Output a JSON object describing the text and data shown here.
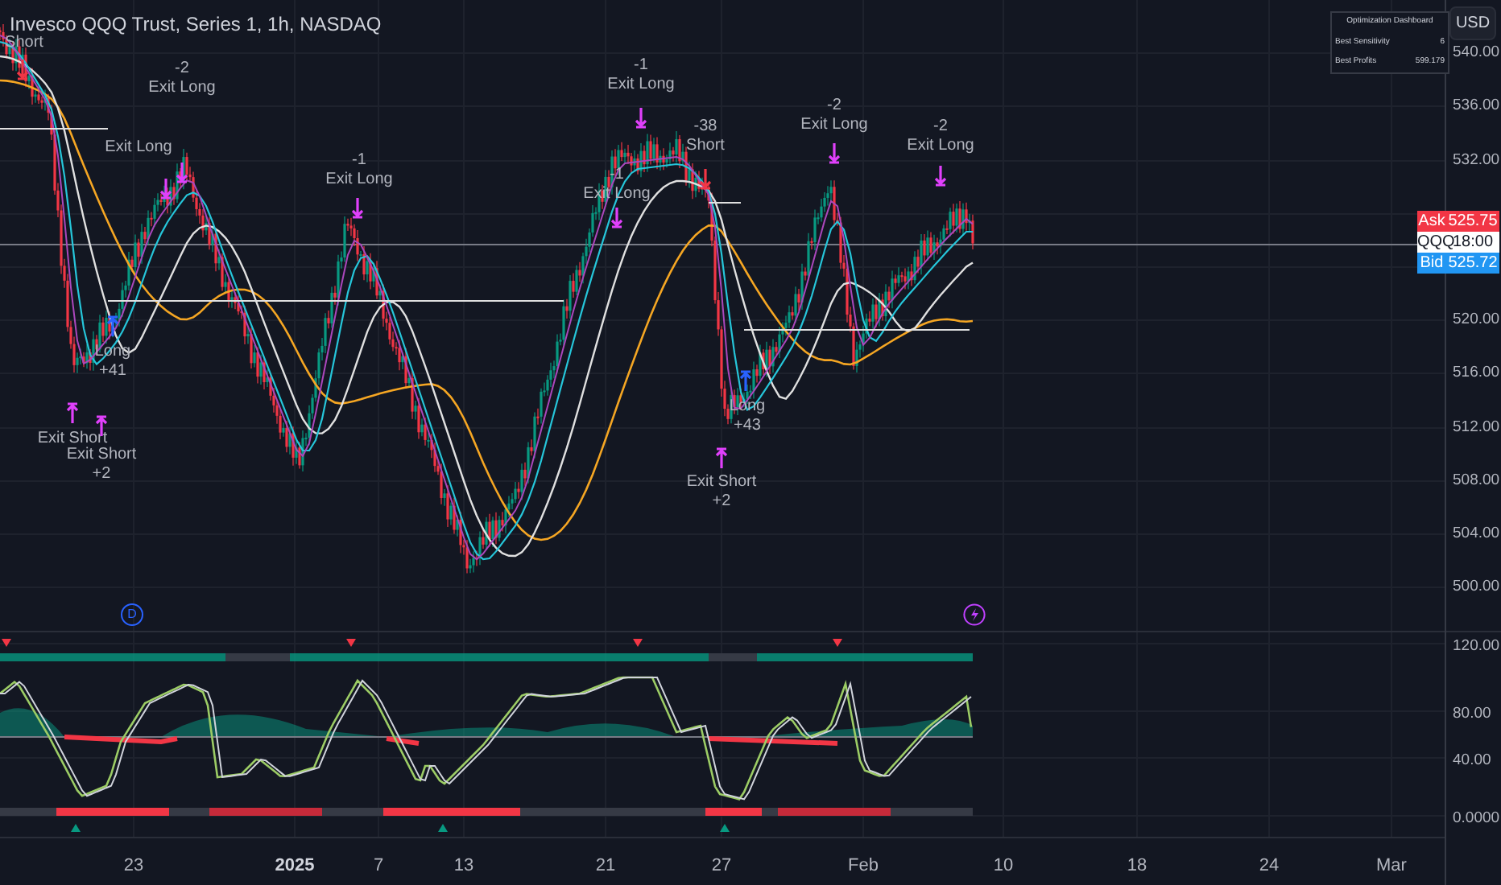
{
  "header": {
    "title": "Invesco QQQ Trust, Series 1, 1h, NASDAQ"
  },
  "currency_button": "USD",
  "dashboard": {
    "title": "Optimization Dashboard",
    "rows": [
      {
        "label": "Best Sensitivity",
        "value": "6"
      },
      {
        "label": "Best Profits",
        "value": "599.179"
      }
    ]
  },
  "price_axis": [
    "540.00",
    "536.00",
    "532.00",
    "520.00",
    "516.00",
    "512.00",
    "508.00",
    "504.00",
    "500.00"
  ],
  "quote_tags": [
    {
      "kind": "ask",
      "label": "Ask",
      "value": "525.75"
    },
    {
      "kind": "symbol",
      "label": "QQQ",
      "value": "18:00"
    },
    {
      "kind": "bid",
      "label": "Bid",
      "value": "525.72"
    }
  ],
  "trades": [
    {
      "kind": "short",
      "lines": [
        "Short"
      ]
    },
    {
      "kind": "exit_long",
      "lines": [
        "-2",
        "Exit Long"
      ]
    },
    {
      "kind": "exit_long",
      "lines": [
        "Exit Long"
      ]
    },
    {
      "kind": "exit_long",
      "lines": [
        "-1",
        "Exit Long"
      ]
    },
    {
      "kind": "exit_long",
      "lines": [
        "-1",
        "Exit Long"
      ]
    },
    {
      "kind": "exit_long",
      "lines": [
        "-1",
        "Exit Long"
      ]
    },
    {
      "kind": "short",
      "lines": [
        "-38",
        "Short"
      ]
    },
    {
      "kind": "exit_long",
      "lines": [
        "-2",
        "Exit Long"
      ]
    },
    {
      "kind": "exit_long",
      "lines": [
        "-2",
        "Exit Long"
      ]
    },
    {
      "kind": "long",
      "lines": [
        "Long",
        "+41"
      ]
    },
    {
      "kind": "exit_short",
      "lines": [
        "Exit Short"
      ]
    },
    {
      "kind": "exit_short",
      "lines": [
        "Exit Short",
        "+2"
      ]
    },
    {
      "kind": "long",
      "lines": [
        "Long",
        "+43"
      ]
    },
    {
      "kind": "exit_short",
      "lines": [
        "Exit Short",
        "+2"
      ]
    }
  ],
  "markers": [
    {
      "kind": "dividend",
      "label": "D"
    },
    {
      "kind": "event"
    }
  ],
  "oscillator_axis": [
    "120.00",
    "80.00",
    "40.00",
    "0.0000"
  ],
  "time_axis": [
    {
      "label": "23",
      "emphasis": false
    },
    {
      "label": "2025",
      "emphasis": true
    },
    {
      "label": "7",
      "emphasis": false
    },
    {
      "label": "13",
      "emphasis": false
    },
    {
      "label": "21",
      "emphasis": false
    },
    {
      "label": "27",
      "emphasis": false
    },
    {
      "label": "Feb",
      "emphasis": false
    },
    {
      "label": "10",
      "emphasis": false
    },
    {
      "label": "18",
      "emphasis": false
    },
    {
      "label": "24",
      "emphasis": false
    },
    {
      "label": "Mar",
      "emphasis": false
    }
  ]
}
